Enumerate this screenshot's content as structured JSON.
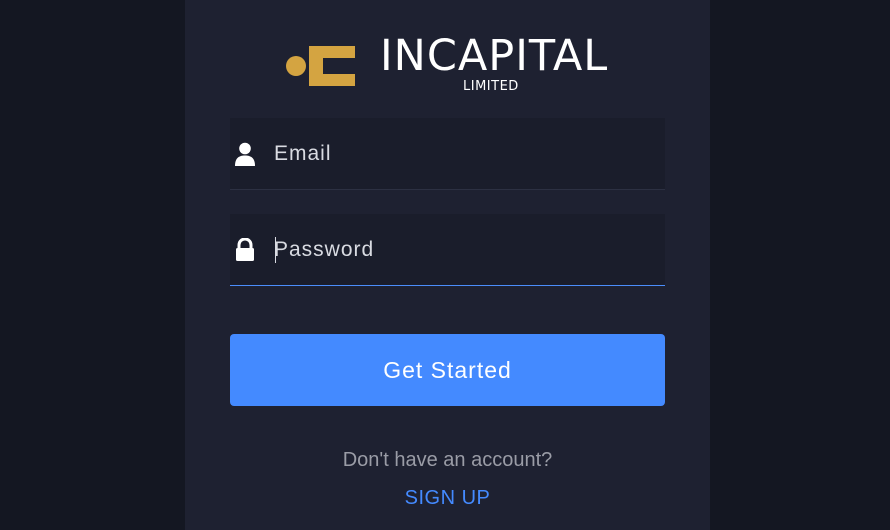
{
  "brand": {
    "name": "INCAPITAL",
    "subtitle": "LIMITED",
    "logo_color": "#d4a441"
  },
  "login_form": {
    "email": {
      "icon": "user-icon",
      "placeholder": "Email",
      "value": ""
    },
    "password": {
      "icon": "lock-icon",
      "placeholder": "Password",
      "value": ""
    },
    "submit_label": "Get Started"
  },
  "footer": {
    "account_prompt": "Don't have an account?",
    "signup_label": "SIGN UP"
  },
  "colors": {
    "background": "#141722",
    "panel": "#1e2131",
    "accent": "#448aff"
  }
}
